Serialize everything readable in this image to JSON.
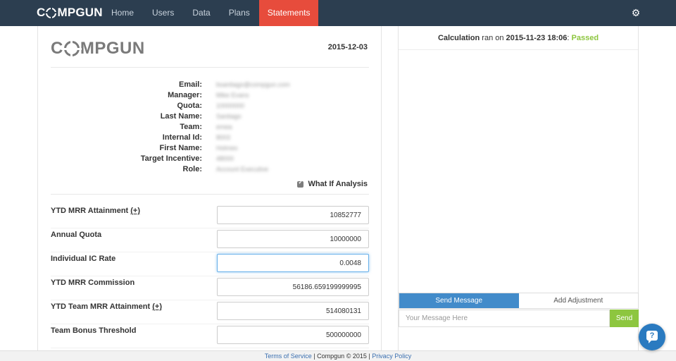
{
  "navbar": {
    "brand": {
      "pre": "C",
      "post": "MPGUN"
    },
    "links": [
      "Home",
      "Users",
      "Data",
      "Plans",
      "Statements"
    ],
    "active": "Statements"
  },
  "statement": {
    "logo": {
      "pre": "C",
      "post": "MPGUN"
    },
    "date": "2015-12-03",
    "info": [
      {
        "label": "Email:",
        "value": "bsantiago@compgun.com"
      },
      {
        "label": "Manager:",
        "value": "Mike Evans"
      },
      {
        "label": "Quota:",
        "value": "10000000"
      },
      {
        "label": "Last Name:",
        "value": "Santiago"
      },
      {
        "label": "Team:",
        "value": "emea"
      },
      {
        "label": "Internal Id:",
        "value": "8003"
      },
      {
        "label": "First Name:",
        "value": "Holmes"
      },
      {
        "label": "Target Incentive:",
        "value": "48000"
      },
      {
        "label": "Role:",
        "value": "Account Executive"
      }
    ],
    "whatif_label": "What If Analysis",
    "fields": [
      {
        "label": "YTD MRR Attainment",
        "plus": "(+)",
        "value": "10852777"
      },
      {
        "label": "Annual Quota",
        "plus": "",
        "value": "10000000"
      },
      {
        "label": "Individual IC Rate",
        "plus": "",
        "value": "0.0048"
      },
      {
        "label": "YTD MRR Commission",
        "plus": "",
        "value": "56186.659199999995"
      },
      {
        "label": "YTD Team MRR Attainment",
        "plus": "(+)",
        "value": "514080131"
      },
      {
        "label": "Team Bonus Threshold",
        "plus": "",
        "value": "500000000"
      }
    ]
  },
  "calculation": {
    "prefix": "Calculation",
    "mid": " ran on ",
    "datetime": "2015-11-23 18:06",
    "sep": ": ",
    "status": "Passed"
  },
  "messaging": {
    "tabs": [
      "Send Message",
      "Add Adjustment"
    ],
    "placeholder": "Your Message Here",
    "send_label": "Send"
  },
  "footer": {
    "terms": "Terms of Service",
    "middle": " | Compgun © 2015 | ",
    "privacy": "Privacy Policy"
  },
  "help": {
    "label": "?"
  },
  "colors": {
    "navbar": "#2c3e50",
    "active_tab": "#e74c3c",
    "passed": "#8dc63f",
    "send_message_tab": "#428bca",
    "help_button": "#2a7ac0"
  },
  "icons": {
    "settings": "gear-icon",
    "help": "help-chat-icon"
  }
}
